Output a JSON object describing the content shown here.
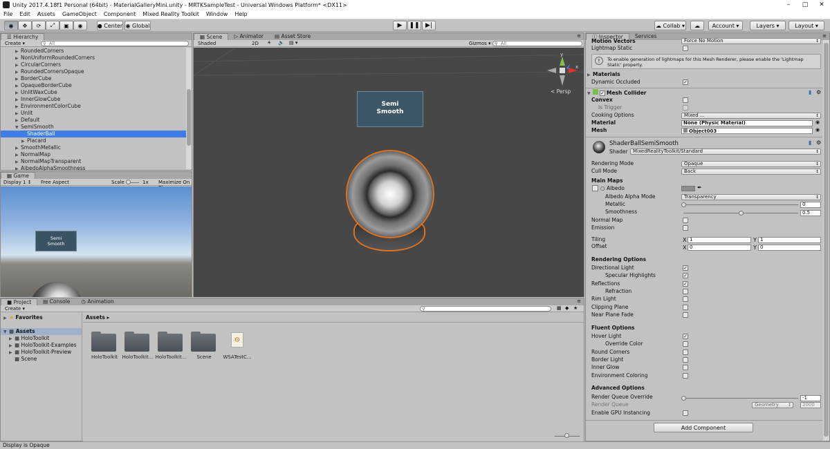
{
  "window": {
    "title": "Unity 2017.4.18f1 Personal (64bit) - MaterialGalleryMini.unity - MRTKSampleTest - Universal Windows Platform* <DX11>"
  },
  "menu": [
    "File",
    "Edit",
    "Assets",
    "GameObject",
    "Component",
    "Mixed Reality Toolkit",
    "Window",
    "Help"
  ],
  "toolbar": {
    "center": "Center",
    "global": "Global",
    "collab": "Collab",
    "account": "Account",
    "layers": "Layers",
    "layout": "Layout"
  },
  "hierarchy": {
    "tab": "Hierarchy",
    "create": "Create",
    "search_placeholder": "All",
    "items": [
      {
        "label": "RoundedCorners",
        "indent": 1,
        "arrow": true
      },
      {
        "label": "NonUniformRoundedCorners",
        "indent": 1,
        "arrow": true
      },
      {
        "label": "CircularCorners",
        "indent": 1,
        "arrow": true
      },
      {
        "label": "RoundedCornersOpaque",
        "indent": 1,
        "arrow": true
      },
      {
        "label": "BorderCube",
        "indent": 1,
        "arrow": true
      },
      {
        "label": "OpaqueBorderCube",
        "indent": 1,
        "arrow": true
      },
      {
        "label": "UnlitWaxCube",
        "indent": 1,
        "arrow": true
      },
      {
        "label": "InnerGlowCube",
        "indent": 1,
        "arrow": true
      },
      {
        "label": "EnvironmentColorCube",
        "indent": 1,
        "arrow": true
      },
      {
        "label": "Unlit",
        "indent": 1,
        "arrow": true
      },
      {
        "label": "Default",
        "indent": 1,
        "arrow": true
      },
      {
        "label": "SemiSmooth",
        "indent": 1,
        "arrow": true,
        "open": true
      },
      {
        "label": "ShaderBall",
        "indent": 2,
        "arrow": false,
        "selected": true
      },
      {
        "label": "Placard",
        "indent": 2,
        "arrow": true
      },
      {
        "label": "SmoothMetallic",
        "indent": 1,
        "arrow": true
      },
      {
        "label": "NormalMap",
        "indent": 1,
        "arrow": true
      },
      {
        "label": "NormalMapTransparent",
        "indent": 1,
        "arrow": true
      },
      {
        "label": "AlbedoAlphaSmoothness",
        "indent": 1,
        "arrow": true
      }
    ]
  },
  "scene": {
    "tabs": [
      "Scene",
      "Animator",
      "Asset Store"
    ],
    "shaded": "Shaded",
    "mode2d": "2D",
    "gizmos": "Gizmos",
    "search_placeholder": "All",
    "persp": "< Persp",
    "axis_x": "x",
    "axis_y": "y",
    "placard_line1": "Semi",
    "placard_line2": "Smooth"
  },
  "game": {
    "tab": "Game",
    "display": "Display 1",
    "aspect": "Free Aspect",
    "scale_label": "Scale",
    "scale_value": "1x",
    "maximize": "Maximize On Pl",
    "placard_line1": "Semi",
    "placard_line2": "Smooth"
  },
  "project": {
    "tabs": [
      "Project",
      "Console",
      "Animation"
    ],
    "create": "Create",
    "favorites": "Favorites",
    "assets_root": "Assets",
    "tree": [
      "HoloToolkit",
      "HoloToolkit-Examples",
      "HoloToolkit-Preview",
      "Scene"
    ],
    "breadcrumb": "Assets",
    "items": [
      {
        "label": "HoloToolkit",
        "kind": "folder"
      },
      {
        "label": "HoloToolkit...",
        "kind": "folder"
      },
      {
        "label": "HoloToolkit...",
        "kind": "folder"
      },
      {
        "label": "Scene",
        "kind": "folder"
      },
      {
        "label": "WSATestC...",
        "kind": "file"
      }
    ]
  },
  "status": {
    "text": "Display is Opaque"
  },
  "inspector": {
    "tabs": [
      "Inspector",
      "Services"
    ],
    "motion_vectors": "Motion Vectors",
    "motion_vectors_value": "Force No Motion",
    "lightmap_static": "Lightmap Static",
    "info": "To enable generation of lightmaps for this Mesh Renderer, please enable the 'Lightmap Static' property.",
    "materials": "Materials",
    "dynamic_occluded": "Dynamic Occluded",
    "mesh_collider": "Mesh Collider",
    "convex": "Convex",
    "is_trigger": "Is Trigger",
    "cooking_options": "Cooking Options",
    "cooking_value": "Mixed ...",
    "material": "Material",
    "material_value": "None (Physic Material)",
    "mesh": "Mesh",
    "mesh_value": "Object003",
    "material_name": "ShaderBallSemiSmooth",
    "shader_label": "Shader",
    "shader_value": "MixedRealityToolkit/Standard",
    "rendering_mode": "Rendering Mode",
    "rendering_mode_value": "Opaque",
    "cull_mode": "Cull Mode",
    "cull_mode_value": "Back",
    "main_maps": "Main Maps",
    "albedo": "Albedo",
    "albedo_alpha_mode": "Albedo Alpha Mode",
    "albedo_alpha_value": "Transparency",
    "metallic": "Metallic",
    "metallic_value": "0",
    "metallic_level": 0.0,
    "smoothness": "Smoothness",
    "smoothness_value": "0.5",
    "smoothness_level": 0.5,
    "normal_map": "Normal Map",
    "emission": "Emission",
    "tiling": "Tiling",
    "offset": "Offset",
    "tiling_x": "1",
    "tiling_y": "1",
    "offset_x": "0",
    "offset_y": "0",
    "x": "X",
    "y": "Y",
    "rendering_options": "Rendering Options",
    "directional_light": "Directional Light",
    "specular_highlights": "Specular Highlights",
    "reflections": "Reflections",
    "refraction": "Refraction",
    "rim_light": "Rim Light",
    "clipping_plane": "Clipping Plane",
    "near_plane_fade": "Near Plane Fade",
    "fluent_options": "Fluent Options",
    "hover_light": "Hover Light",
    "override_color": "Override Color",
    "round_corners": "Round Corners",
    "border_light": "Border Light",
    "inner_glow": "Inner Glow",
    "environment_coloring": "Environment Coloring",
    "advanced_options": "Advanced Options",
    "render_queue_override": "Render Queue Override",
    "render_queue_override_value": "-1",
    "render_queue": "Render Queue",
    "render_queue_mode": "Geometry",
    "render_queue_value": "2000",
    "enable_gpu_instancing": "Enable GPU Instancing",
    "add_component": "Add Component"
  }
}
